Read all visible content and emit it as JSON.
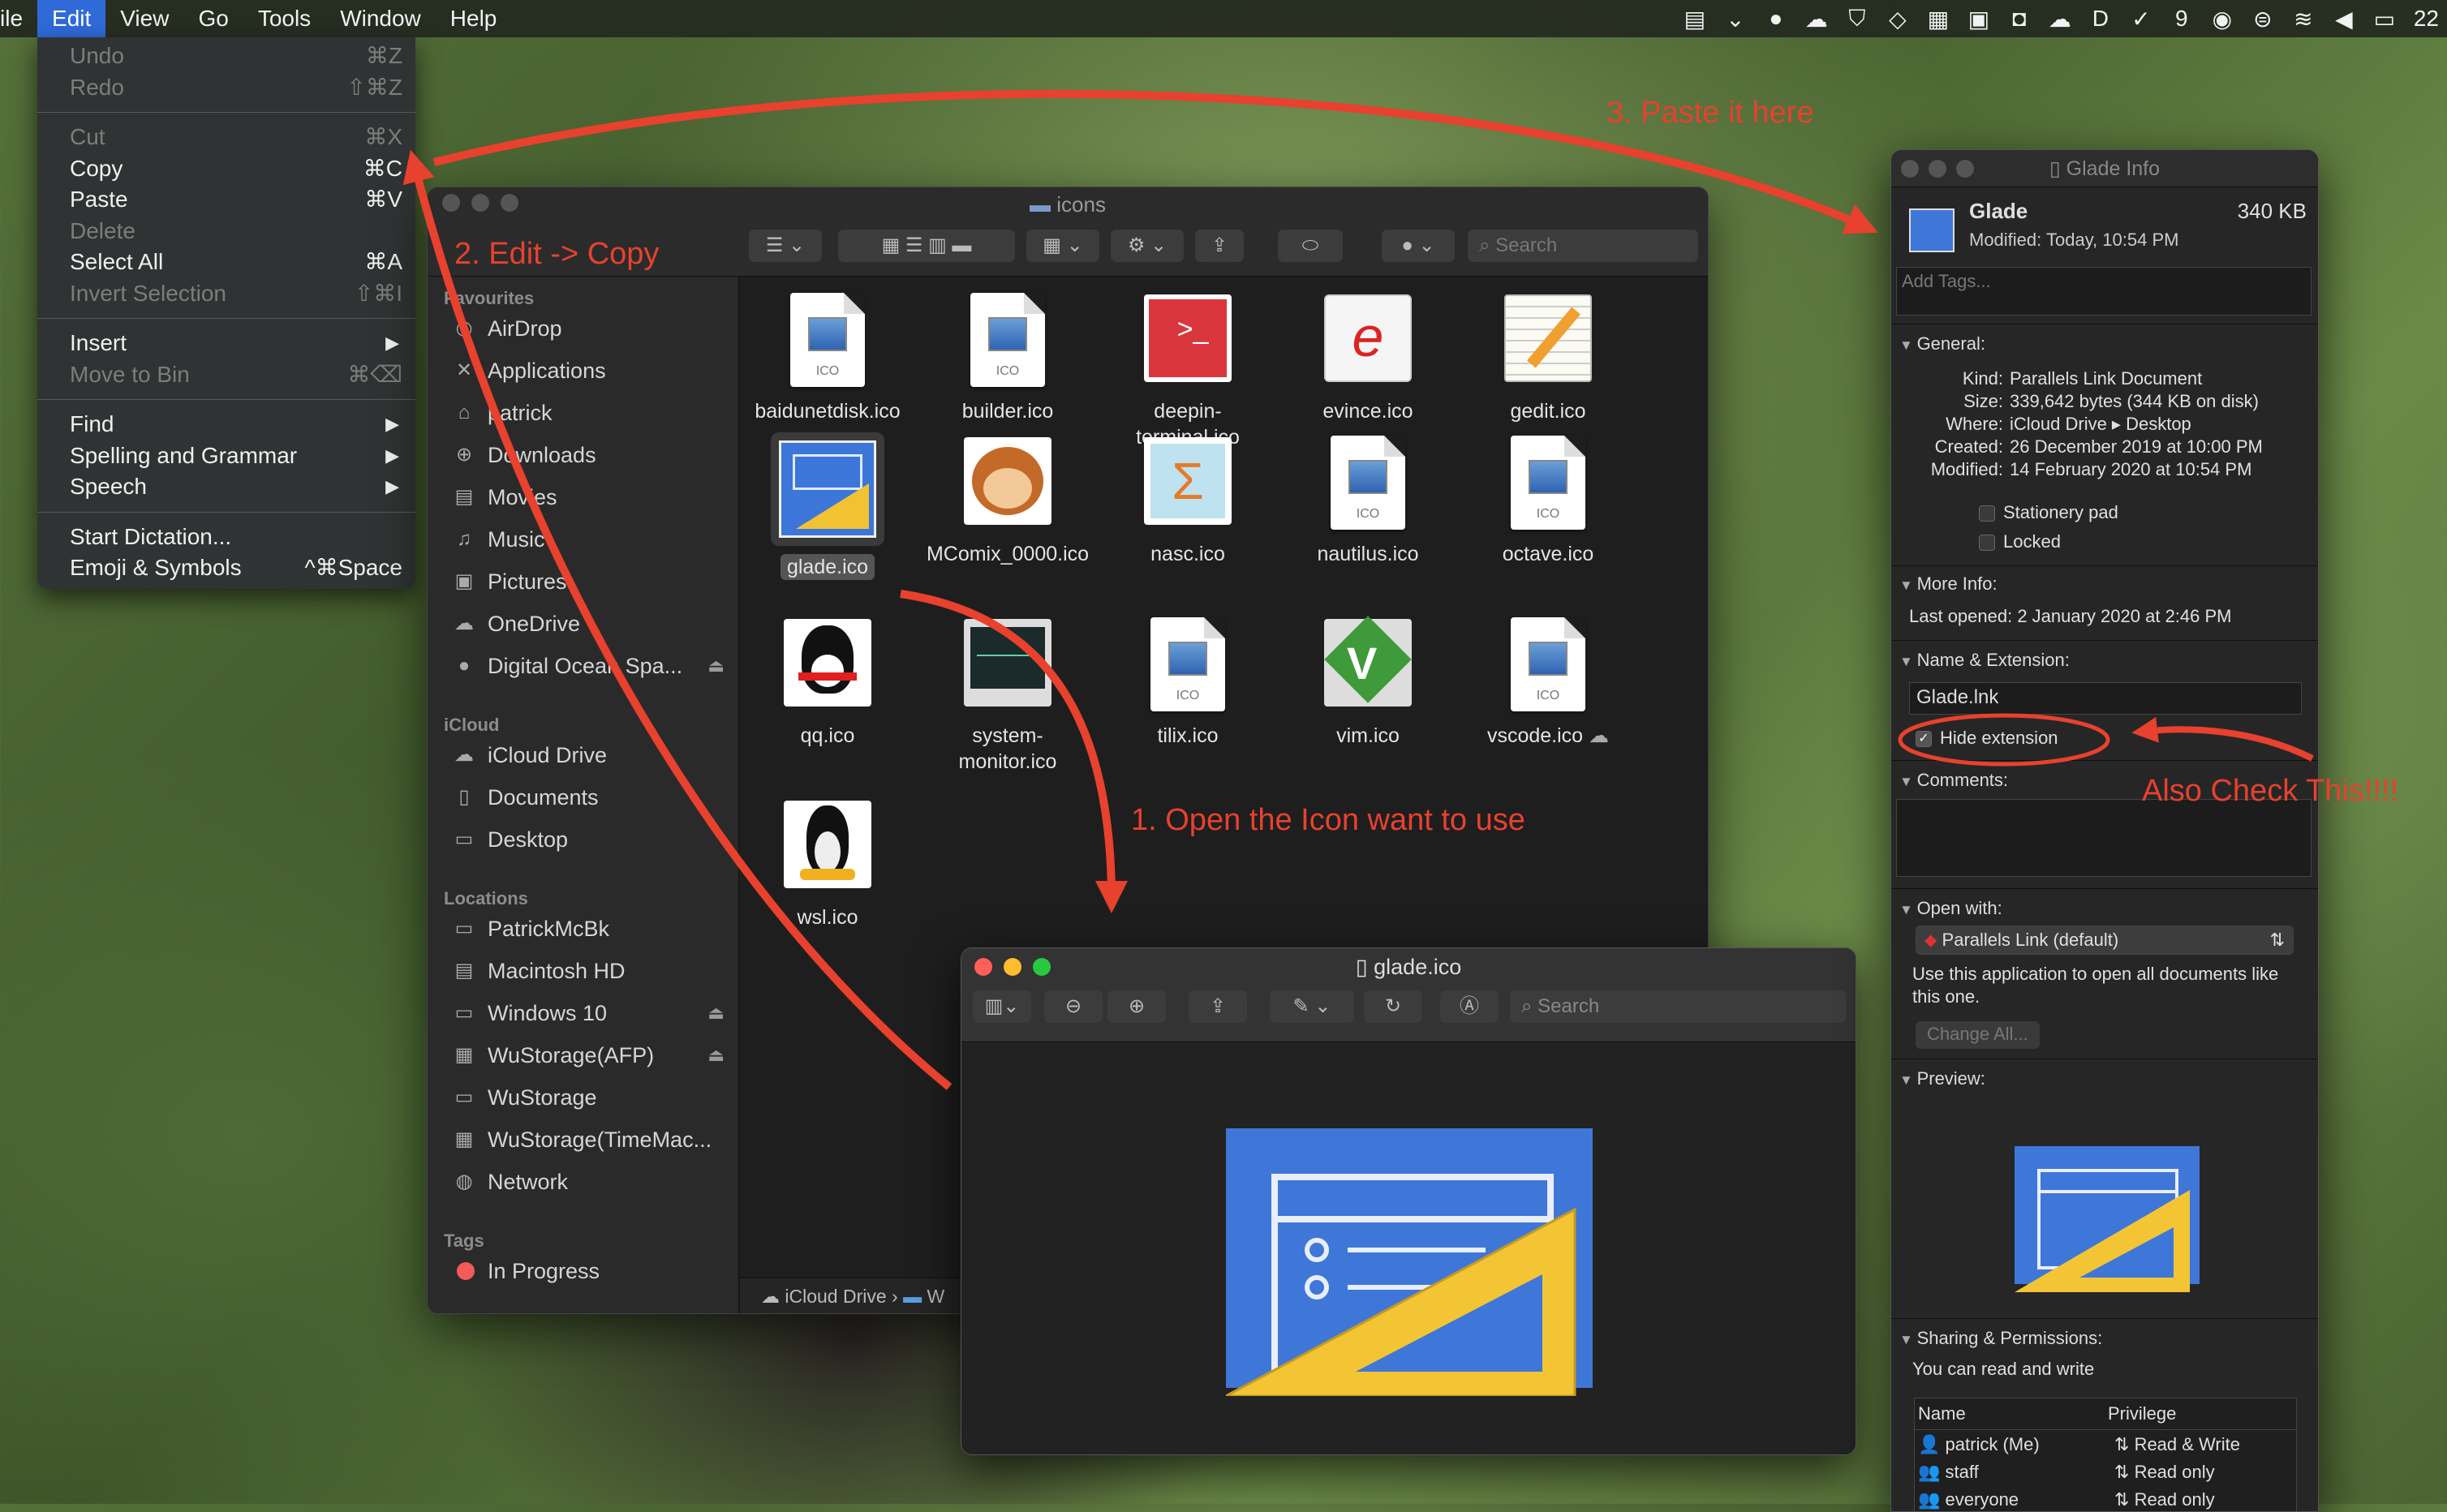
{
  "menubar": {
    "items": [
      "ile",
      "Edit",
      "View",
      "Go",
      "Tools",
      "Window",
      "Help"
    ],
    "status": {
      "clock": "22",
      "number": "9"
    }
  },
  "edit_menu": {
    "undo": "Undo",
    "undo_sc": "⌘Z",
    "redo": "Redo",
    "redo_sc": "⇧⌘Z",
    "cut": "Cut",
    "cut_sc": "⌘X",
    "copy": "Copy",
    "copy_sc": "⌘C",
    "paste": "Paste",
    "paste_sc": "⌘V",
    "delete": "Delete",
    "select_all": "Select All",
    "select_all_sc": "⌘A",
    "invert": "Invert Selection",
    "invert_sc": "⇧⌘I",
    "insert": "Insert",
    "move_to_bin": "Move to Bin",
    "move_to_bin_sc": "⌘⌫",
    "find": "Find",
    "spelling": "Spelling and Grammar",
    "speech": "Speech",
    "dictation": "Start Dictation...",
    "emoji": "Emoji & Symbols",
    "emoji_sc": "^⌘Space"
  },
  "finder": {
    "title": "icons",
    "search_placeholder": "Search",
    "sidebar": {
      "favourites_title": "Favourites",
      "favourites": [
        "AirDrop",
        "Applications",
        "patrick",
        "Downloads",
        "Movies",
        "Music",
        "Pictures",
        "OneDrive",
        "Digital Ocean Spa..."
      ],
      "icloud_title": "iCloud",
      "icloud": [
        "iCloud Drive",
        "Documents",
        "Desktop"
      ],
      "locations_title": "Locations",
      "locations": [
        "PatrickMcBk",
        "Macintosh HD",
        "Windows 10",
        "WuStorage(AFP)",
        "WuStorage",
        "WuStorage(TimeMac...",
        "Network"
      ],
      "tags_title": "Tags",
      "tags": [
        "In Progress"
      ]
    },
    "files": [
      {
        "name": "baidunetdisk.ico"
      },
      {
        "name": "builder.ico"
      },
      {
        "name": "deepin-terminal.ico"
      },
      {
        "name": "evince.ico"
      },
      {
        "name": "gedit.ico"
      },
      {
        "name": "glade.ico"
      },
      {
        "name": "MComix_0000.ico"
      },
      {
        "name": "nasc.ico"
      },
      {
        "name": "nautilus.ico"
      },
      {
        "name": "octave.ico"
      },
      {
        "name": "qq.ico"
      },
      {
        "name": "system-monitor.ico"
      },
      {
        "name": "tilix.ico"
      },
      {
        "name": "vim.ico"
      },
      {
        "name": "vscode.ico"
      },
      {
        "name": "wsl.ico"
      }
    ],
    "ico_badge": "ICO",
    "path": [
      "iCloud Drive",
      "W"
    ]
  },
  "preview": {
    "title": "glade.ico",
    "search_placeholder": "Search"
  },
  "info": {
    "window_title": "Glade Info",
    "name": "Glade",
    "size": "340 KB",
    "modified_line": "Modified: Today, 10:54 PM",
    "tags_placeholder": "Add Tags...",
    "general_title": "General:",
    "kind_label": "Kind:",
    "kind": "Parallels Link Document",
    "size_label": "Size:",
    "size_full": "339,642 bytes (344 KB on disk)",
    "where_label": "Where:",
    "where": "iCloud Drive ▸ Desktop",
    "created_label": "Created:",
    "created": "26 December 2019 at 10:00 PM",
    "modified_label": "Modified:",
    "modified": "14 February 2020 at 10:54 PM",
    "stationery": "Stationery pad",
    "locked": "Locked",
    "more_info_title": "More Info:",
    "last_opened": "Last opened: 2 January 2020 at 2:46 PM",
    "name_ext_title": "Name & Extension:",
    "name_field": "Glade.lnk",
    "hide_ext": "Hide extension",
    "comments_title": "Comments:",
    "open_with_title": "Open with:",
    "open_with_app": "Parallels Link (default)",
    "open_with_desc": "Use this application to open all documents like this one.",
    "change_all": "Change All...",
    "preview_title": "Preview:",
    "sharing_title": "Sharing & Permissions:",
    "sharing_desc": "You can read and write",
    "perm_name_col": "Name",
    "perm_priv_col": "Privilege",
    "perms": [
      {
        "name": "patrick (Me)",
        "priv": "Read & Write"
      },
      {
        "name": "staff",
        "priv": "Read only"
      },
      {
        "name": "everyone",
        "priv": "Read only"
      }
    ]
  },
  "annotations": {
    "step1": "1. Open the Icon want to use",
    "step2": "2. Edit -> Copy",
    "step3": "3. Paste it here",
    "also": "Also Check This!!!!",
    "color": "#e8412e"
  }
}
